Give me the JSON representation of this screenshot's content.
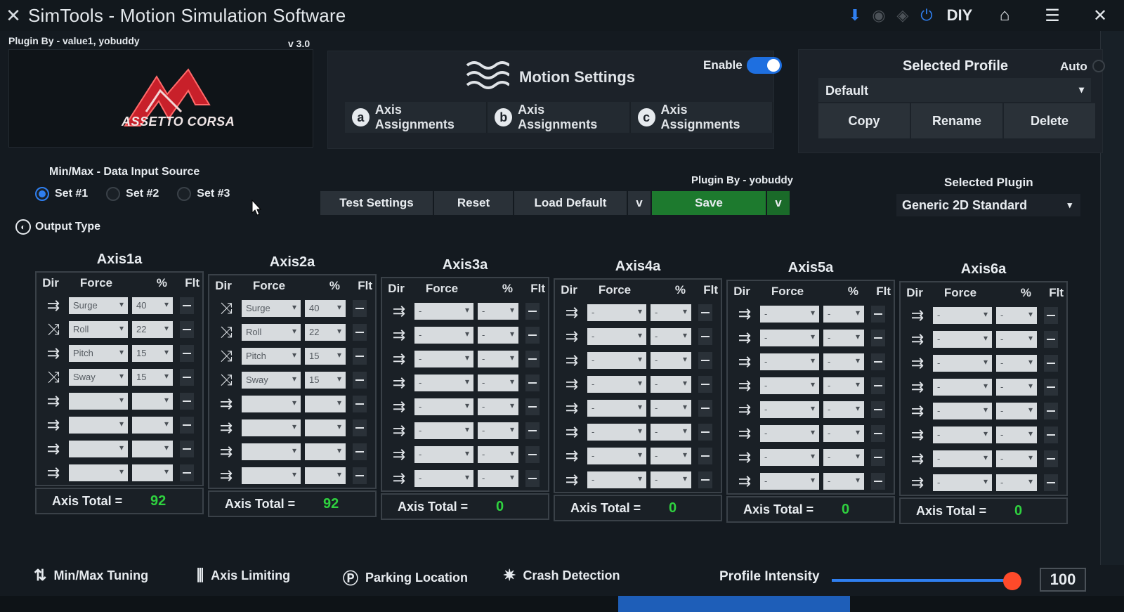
{
  "titlebar": {
    "title": "SimTools - Motion Simulation Software",
    "diy_label": "DIY",
    "icons": [
      "download-icon",
      "status-icon-1",
      "status-icon-2",
      "power-icon",
      "home-icon",
      "menu-icon",
      "close-icon"
    ]
  },
  "game": {
    "plugin_by": "Plugin By - value1, yobuddy",
    "version": "v 3.0",
    "logo_text": "ASSETTO CORSA"
  },
  "motion": {
    "title": "Motion Settings",
    "enable_label": "Enable",
    "enabled": true,
    "tabs": [
      {
        "letter": "a",
        "label": "Axis Assignments"
      },
      {
        "letter": "b",
        "label": "Axis Assignments"
      },
      {
        "letter": "c",
        "label": "Axis Assignments"
      }
    ]
  },
  "profile": {
    "title": "Selected Profile",
    "auto_label": "Auto",
    "selected": "Default",
    "buttons": [
      "Copy",
      "Rename",
      "Delete"
    ]
  },
  "input_source": {
    "label": "Min/Max - Data Input Source",
    "sets": [
      "Set #1",
      "Set #2",
      "Set #3"
    ],
    "selected_index": 0
  },
  "output_type_label": "Output Type",
  "actions": {
    "plugin_by": "Plugin By - yobuddy",
    "test": "Test Settings",
    "reset": "Reset",
    "load_default": "Load Default",
    "dropdown": "v",
    "save": "Save"
  },
  "plugin": {
    "label": "Selected Plugin",
    "selected": "Generic 2D Standard"
  },
  "axis_headers": {
    "dir": "Dir",
    "force": "Force",
    "pct": "%",
    "flt": "Flt"
  },
  "total_label": "Axis Total =",
  "axes": [
    {
      "name": "Axis1a",
      "total": "92",
      "rows": [
        {
          "dir": "⇉",
          "force": "Surge",
          "pct": "40"
        },
        {
          "dir": "⤨",
          "force": "Roll",
          "pct": "22"
        },
        {
          "dir": "⇉",
          "force": "Pitch",
          "pct": "15"
        },
        {
          "dir": "⤨",
          "force": "Sway",
          "pct": "15"
        },
        {
          "dir": "⇉",
          "force": "",
          "pct": ""
        },
        {
          "dir": "⇉",
          "force": "",
          "pct": ""
        },
        {
          "dir": "⇉",
          "force": "",
          "pct": ""
        },
        {
          "dir": "⇉",
          "force": "",
          "pct": ""
        }
      ]
    },
    {
      "name": "Axis2a",
      "total": "92",
      "rows": [
        {
          "dir": "⤨",
          "force": "Surge",
          "pct": "40"
        },
        {
          "dir": "⤨",
          "force": "Roll",
          "pct": "22"
        },
        {
          "dir": "⤨",
          "force": "Pitch",
          "pct": "15"
        },
        {
          "dir": "⤨",
          "force": "Sway",
          "pct": "15"
        },
        {
          "dir": "⇉",
          "force": "",
          "pct": ""
        },
        {
          "dir": "⇉",
          "force": "",
          "pct": ""
        },
        {
          "dir": "⇉",
          "force": "",
          "pct": ""
        },
        {
          "dir": "⇉",
          "force": "",
          "pct": ""
        }
      ]
    },
    {
      "name": "Axis3a",
      "total": "0",
      "rows": [
        {
          "dir": "⇉",
          "force": "-",
          "pct": "-"
        },
        {
          "dir": "⇉",
          "force": "-",
          "pct": "-"
        },
        {
          "dir": "⇉",
          "force": "-",
          "pct": "-"
        },
        {
          "dir": "⇉",
          "force": "-",
          "pct": "-"
        },
        {
          "dir": "⇉",
          "force": "-",
          "pct": "-"
        },
        {
          "dir": "⇉",
          "force": "-",
          "pct": "-"
        },
        {
          "dir": "⇉",
          "force": "-",
          "pct": "-"
        },
        {
          "dir": "⇉",
          "force": "-",
          "pct": "-"
        }
      ]
    },
    {
      "name": "Axis4a",
      "total": "0",
      "rows": [
        {
          "dir": "⇉",
          "force": "-",
          "pct": "-"
        },
        {
          "dir": "⇉",
          "force": "-",
          "pct": "-"
        },
        {
          "dir": "⇉",
          "force": "-",
          "pct": "-"
        },
        {
          "dir": "⇉",
          "force": "-",
          "pct": "-"
        },
        {
          "dir": "⇉",
          "force": "-",
          "pct": "-"
        },
        {
          "dir": "⇉",
          "force": "-",
          "pct": "-"
        },
        {
          "dir": "⇉",
          "force": "-",
          "pct": "-"
        },
        {
          "dir": "⇉",
          "force": "-",
          "pct": "-"
        }
      ]
    },
    {
      "name": "Axis5a",
      "total": "0",
      "rows": [
        {
          "dir": "⇉",
          "force": "-",
          "pct": "-"
        },
        {
          "dir": "⇉",
          "force": "-",
          "pct": "-"
        },
        {
          "dir": "⇉",
          "force": "-",
          "pct": "-"
        },
        {
          "dir": "⇉",
          "force": "-",
          "pct": "-"
        },
        {
          "dir": "⇉",
          "force": "-",
          "pct": "-"
        },
        {
          "dir": "⇉",
          "force": "-",
          "pct": "-"
        },
        {
          "dir": "⇉",
          "force": "-",
          "pct": "-"
        },
        {
          "dir": "⇉",
          "force": "-",
          "pct": "-"
        }
      ]
    },
    {
      "name": "Axis6a",
      "total": "0",
      "rows": [
        {
          "dir": "⇉",
          "force": "-",
          "pct": "-"
        },
        {
          "dir": "⇉",
          "force": "-",
          "pct": "-"
        },
        {
          "dir": "⇉",
          "force": "-",
          "pct": "-"
        },
        {
          "dir": "⇉",
          "force": "-",
          "pct": "-"
        },
        {
          "dir": "⇉",
          "force": "-",
          "pct": "-"
        },
        {
          "dir": "⇉",
          "force": "-",
          "pct": "-"
        },
        {
          "dir": "⇉",
          "force": "-",
          "pct": "-"
        },
        {
          "dir": "⇉",
          "force": "-",
          "pct": "-"
        }
      ]
    }
  ],
  "bottom_nav": [
    {
      "icon": "⇅",
      "label": "Min/Max Tuning"
    },
    {
      "icon": "⫼",
      "label": "Axis Limiting"
    },
    {
      "icon": "Ⓟ",
      "label": "Parking Location"
    },
    {
      "icon": "✷",
      "label": "Crash Detection"
    }
  ],
  "intensity": {
    "label": "Profile Intensity",
    "value": "100",
    "fraction": 0.95
  },
  "colors": {
    "accent": "#2f7ff0",
    "save": "#1d7a2e",
    "total": "#2fd13f",
    "slider_thumb": "#ff4a2a"
  }
}
